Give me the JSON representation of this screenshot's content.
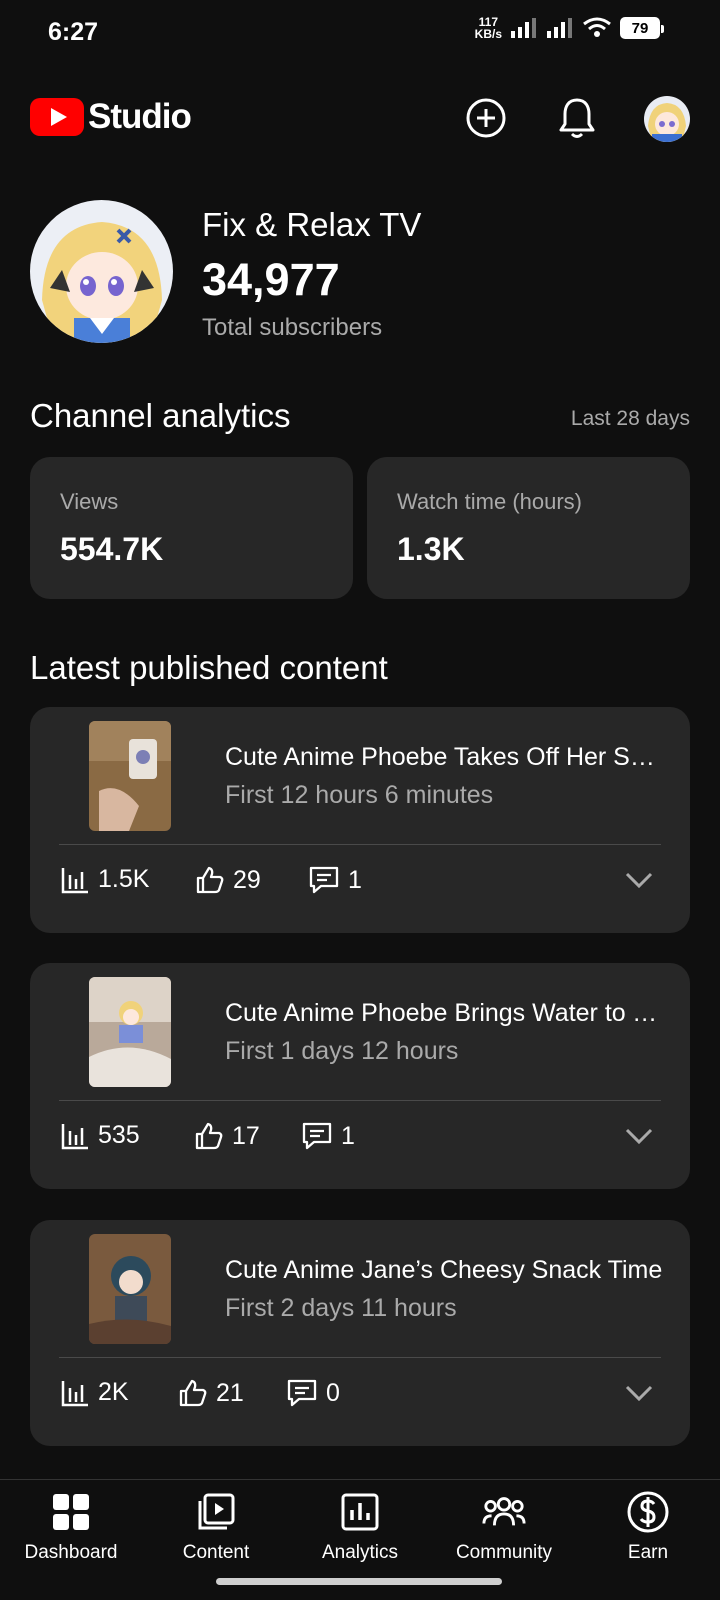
{
  "status": {
    "time": "6:27",
    "speed_value": "117",
    "speed_unit": "KB/s",
    "battery": "79"
  },
  "header": {
    "logo_text": "Studio"
  },
  "channel": {
    "name": "Fix & Relax TV",
    "subscribers": "34,977",
    "subscribers_label": "Total subscribers"
  },
  "analytics": {
    "title": "Channel analytics",
    "range": "Last 28 days",
    "cards": [
      {
        "label": "Views",
        "value": "554.7K"
      },
      {
        "label": "Watch time (hours)",
        "value": "1.3K"
      }
    ]
  },
  "latest": {
    "title": "Latest published content",
    "videos": [
      {
        "title": "Cute Anime Phoebe Takes Off Her Shoes",
        "period": "First 12 hours 6 minutes",
        "views": "1.5K",
        "likes": "29",
        "comments": "1"
      },
      {
        "title": "Cute Anime Phoebe Brings Water to You",
        "period": "First 1 days 12 hours",
        "views": "535",
        "likes": "17",
        "comments": "1"
      },
      {
        "title": "Cute Anime Jane’s Cheesy Snack Time",
        "period": "First 2 days 11 hours",
        "views": "2K",
        "likes": "21",
        "comments": "0"
      }
    ]
  },
  "nav": {
    "items": [
      {
        "label": "Dashboard",
        "icon": "dashboard-icon"
      },
      {
        "label": "Content",
        "icon": "content-icon"
      },
      {
        "label": "Analytics",
        "icon": "analytics-icon"
      },
      {
        "label": "Community",
        "icon": "community-icon"
      },
      {
        "label": "Earn",
        "icon": "earn-icon"
      }
    ]
  },
  "colors": {
    "background": "#0f0f0f",
    "card": "#272727",
    "brand": "#ff0000",
    "secondary_text": "#aaaaaa"
  }
}
